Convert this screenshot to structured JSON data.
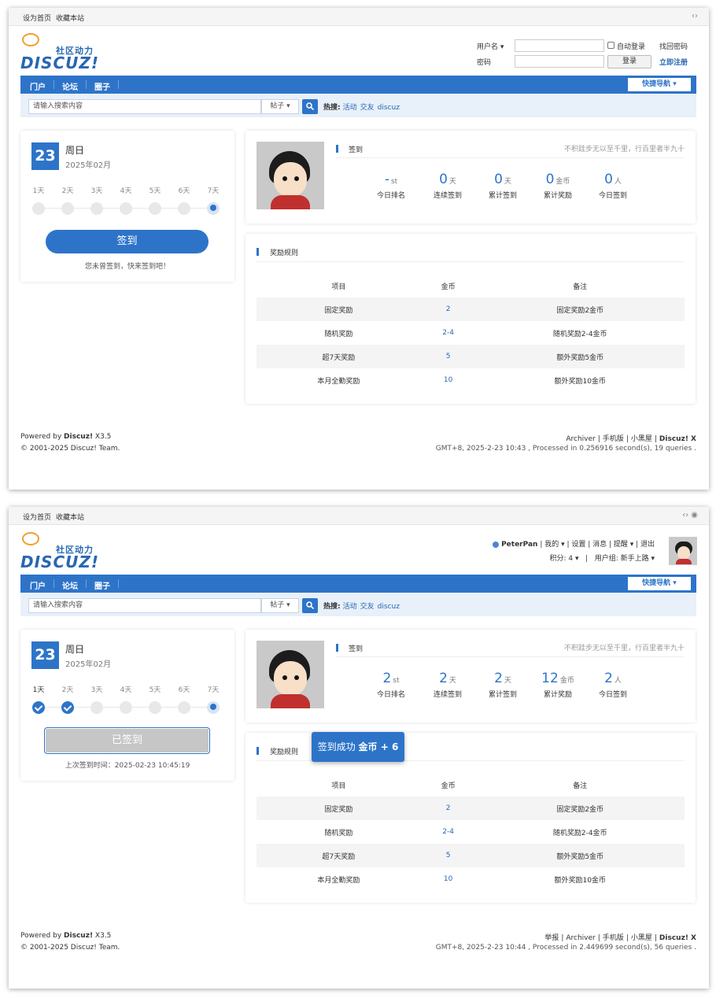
{
  "topbar": {
    "sethome": "设为首页",
    "favorite": "收藏本站"
  },
  "logo": {
    "tagline": "社区动力",
    "wordmark": "DISCUZ!"
  },
  "login": {
    "username_label": "用户名 ▾",
    "password_label": "密码",
    "auto_login": "自动登录",
    "login_button": "登录",
    "forgot": "找回密码",
    "register": "立即注册"
  },
  "nav": {
    "items": [
      "门户",
      "论坛",
      "圈子"
    ],
    "quick": "快捷导航 ▾"
  },
  "search": {
    "placeholder": "请输入搜索内容",
    "type": "帖子 ▾",
    "hot_label": "热搜:",
    "hot": [
      "活动",
      "交友",
      "discuz"
    ]
  },
  "calendar": {
    "day": "23",
    "weekday": "周日",
    "yearmonth": "2025年02月",
    "days": [
      "1天",
      "2天",
      "3天",
      "4天",
      "5天",
      "6天",
      "7天"
    ]
  },
  "state1": {
    "sign_button": "签到",
    "hint": "您未曾签到，快来签到吧！",
    "stats": [
      {
        "num": "-",
        "unit": "st",
        "label": "今日排名"
      },
      {
        "num": "0",
        "unit": "天",
        "label": "连续签到"
      },
      {
        "num": "0",
        "unit": "天",
        "label": "累计签到"
      },
      {
        "num": "0",
        "unit": "金币",
        "label": "累计奖励"
      },
      {
        "num": "0",
        "unit": "人",
        "label": "今日签到"
      }
    ],
    "footer": {
      "links": [
        "Archiver",
        "|",
        "手机版",
        "|",
        "小黑屋",
        "|",
        "Discuz! X"
      ],
      "gmt": "GMT+8, 2025-2-23 10:43 , Processed in 0.256916 second(s), 19 queries ."
    }
  },
  "state2": {
    "sign_button": "已签到",
    "hint": "上次签到时间：2025-02-23 10:45:19",
    "stats": [
      {
        "num": "2",
        "unit": "st",
        "label": "今日排名"
      },
      {
        "num": "2",
        "unit": "天",
        "label": "连续签到"
      },
      {
        "num": "2",
        "unit": "天",
        "label": "累计签到"
      },
      {
        "num": "12",
        "unit": "金币",
        "label": "累计奖励"
      },
      {
        "num": "2",
        "unit": "人",
        "label": "今日签到"
      }
    ],
    "user": {
      "name": "PeterPan",
      "menu": "我的 ▾ | 设置 | 消息 | 提醒 ▾ | 退出",
      "credits": "积分: 4 ▾",
      "group": "用户组: 新手上路 ▾"
    },
    "toast": {
      "text": "签到成功",
      "reward": "金币 + 6"
    },
    "footer": {
      "links": [
        "举报",
        "|",
        "Archiver",
        "|",
        "手机版",
        "|",
        "小黑屋",
        "|",
        "Discuz! X"
      ],
      "gmt": "GMT+8, 2025-2-23 10:44 , Processed in 2.449699 second(s), 56 queries ."
    }
  },
  "signin": {
    "title": "签到",
    "quote": "不积跬步无以至千里，行百里者半九十"
  },
  "rules": {
    "title": "奖励规则",
    "headers": [
      "项目",
      "金币",
      "备注"
    ],
    "rows": [
      [
        "固定奖励",
        "2",
        "固定奖励2金币"
      ],
      [
        "随机奖励",
        "2-4",
        "随机奖励2-4金币"
      ],
      [
        "超7天奖励",
        "5",
        "额外奖励5金币"
      ],
      [
        "本月全勤奖励",
        "10",
        "额外奖励10金币"
      ]
    ]
  },
  "footer": {
    "powered": "Powered by",
    "brand": "Discuz!",
    "version": "X3.5",
    "copyright": "© 2001-2025 Discuz! Team."
  }
}
